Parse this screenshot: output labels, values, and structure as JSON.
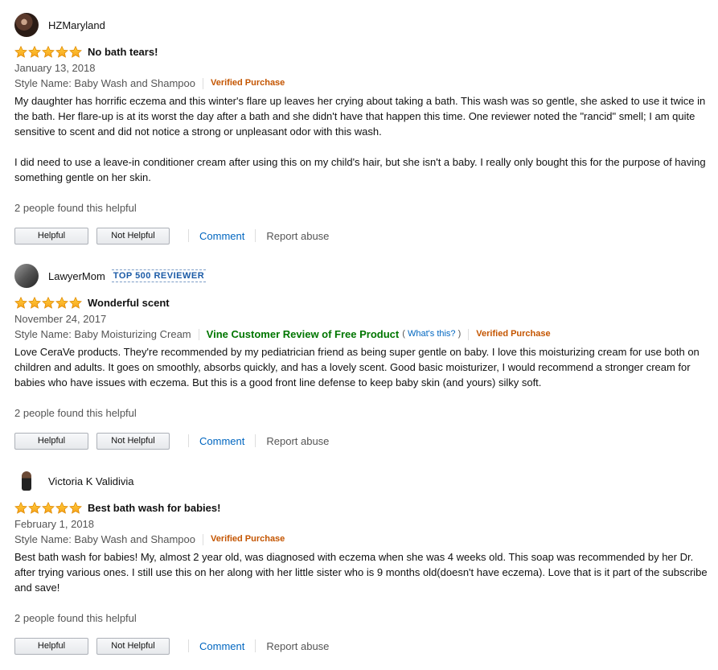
{
  "reviews": [
    {
      "author": "HZMaryland",
      "rating": 5,
      "title": "No bath tears!",
      "date": "January 13, 2018",
      "style": "Style Name: Baby Wash and Shampoo",
      "verified": "Verified Purchase",
      "paragraphs": [
        "My daughter has horrific eczema and this winter's flare up leaves her crying about taking a bath. This wash was so gentle, she asked to use it twice in the bath. Her flare-up is at its worst the day after a bath and she didn't have that happen this time. One reviewer noted the \"rancid\" smell; I am quite sensitive to scent and did not notice a strong or unpleasant odor with this wash.",
        "I did need to use a leave-in conditioner cream after using this on my child's hair, but she isn't a baby. I really only bought this for the purpose of having something gentle on her skin."
      ],
      "helpful_text": "2 people found this helpful",
      "helpful_label": "Helpful",
      "not_helpful_label": "Not Helpful",
      "comment_label": "Comment",
      "report_label": "Report abuse"
    },
    {
      "author": "LawyerMom",
      "badge": "TOP 500 REVIEWER",
      "rating": 5,
      "title": "Wonderful scent",
      "date": "November 24, 2017",
      "style": "Style Name: Baby Moisturizing Cream",
      "vine": "Vine Customer Review of Free Product",
      "whats_open": "(",
      "whats_link": "What's this?",
      "whats_close": ")",
      "verified": "Verified Purchase",
      "paragraphs": [
        "Love CeraVe products. They're recommended by my pediatrician friend as being super gentle on baby. I love this moisturizing cream for use both on children and adults. It goes on smoothly, absorbs quickly, and has a lovely scent. Good basic moisturizer, I would recommend a stronger cream for babies who have issues with eczema. But this is a good front line defense to keep baby skin (and yours) silky soft."
      ],
      "helpful_text": "2 people found this helpful",
      "helpful_label": "Helpful",
      "not_helpful_label": "Not Helpful",
      "comment_label": "Comment",
      "report_label": "Report abuse"
    },
    {
      "author": "Victoria K Validivia",
      "rating": 5,
      "title": "Best bath wash for babies!",
      "date": "February 1, 2018",
      "style": "Style Name: Baby Wash and Shampoo",
      "verified": "Verified Purchase",
      "paragraphs": [
        "Best bath wash for babies! My, almost 2 year old, was diagnosed with eczema when she was 4 weeks old. This soap was recommended by her Dr. after trying various ones. I still use this on her along with her little sister who is 9 months old(doesn't have eczema). Love that is it part of the subscribe and save!"
      ],
      "helpful_text": "2 people found this helpful",
      "helpful_label": "Helpful",
      "not_helpful_label": "Not Helpful",
      "comment_label": "Comment",
      "report_label": "Report abuse"
    }
  ],
  "colors": {
    "star": "#ffa41c",
    "link": "#0066c0",
    "verified": "#c45500",
    "vine": "#007600",
    "badge": "#1a5aa6"
  },
  "icons": [
    "star-icon",
    "avatar"
  ]
}
